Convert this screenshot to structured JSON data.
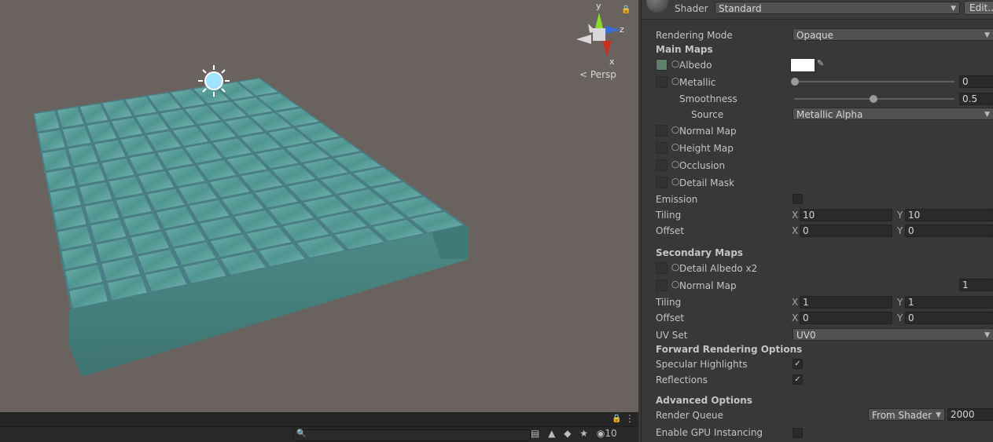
{
  "scene": {
    "persp_label": "Persp",
    "gizmo_axes": {
      "y": "y",
      "z": "z",
      "x": "x"
    },
    "grid_cols": 10,
    "grid_rows": 10
  },
  "bottom_bar": {
    "hidden_count": "10"
  },
  "inspector": {
    "shader_label": "Shader",
    "shader_value": "Standard",
    "edit_button": "Edit...",
    "rendering_mode_label": "Rendering Mode",
    "rendering_mode_value": "Opaque",
    "main_maps_header": "Main Maps",
    "albedo_label": "Albedo",
    "albedo_color": "#ffffff",
    "metallic_label": "Metallic",
    "metallic_value": "0",
    "smoothness_label": "Smoothness",
    "smoothness_value": "0.5",
    "source_label": "Source",
    "source_value": "Metallic Alpha",
    "normal_map_label": "Normal Map",
    "height_map_label": "Height Map",
    "occlusion_label": "Occlusion",
    "detail_mask_label": "Detail Mask",
    "emission_label": "Emission",
    "tiling_label": "Tiling",
    "offset_label": "Offset",
    "x_label": "X",
    "y_label": "Y",
    "main_tiling_x": "10",
    "main_tiling_y": "10",
    "main_offset_x": "0",
    "main_offset_y": "0",
    "secondary_maps_header": "Secondary Maps",
    "detail_albedo_label": "Detail Albedo x2",
    "secondary_normal_label": "Normal Map",
    "secondary_normal_value": "1",
    "sec_tiling_x": "1",
    "sec_tiling_y": "1",
    "sec_offset_x": "0",
    "sec_offset_y": "0",
    "uv_set_label": "UV Set",
    "uv_set_value": "UV0",
    "forward_header": "Forward Rendering Options",
    "specular_label": "Specular Highlights",
    "reflections_label": "Reflections",
    "advanced_header": "Advanced Options",
    "render_queue_label": "Render Queue",
    "render_queue_mode": "From Shader",
    "render_queue_value": "2000",
    "gpu_instancing_label": "Enable GPU Instancing"
  }
}
